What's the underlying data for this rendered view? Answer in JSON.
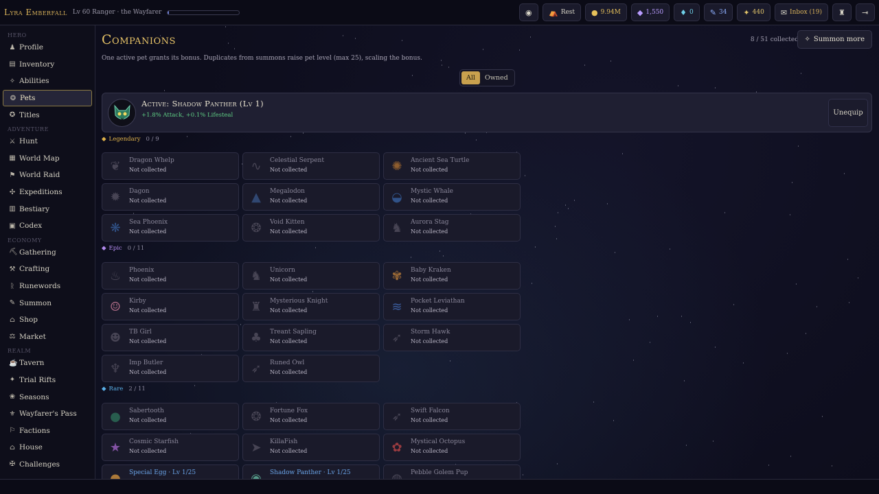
{
  "hero": {
    "name": "Lyra Emberfall",
    "subtitle": "Lv 60 Ranger · the Wayfarer",
    "xp_fraction": 0.02
  },
  "topbar": {
    "rest_label": "Rest",
    "gold": "9.94M",
    "gems": "1,550",
    "shards": "0",
    "scrolls": "34",
    "energy": "440",
    "inbox_label": "Inbox (19)"
  },
  "sidebar": {
    "sections": [
      {
        "title": "Hero",
        "items": [
          {
            "label": "Profile",
            "icon": "person-icon"
          },
          {
            "label": "Inventory",
            "icon": "backpack-icon"
          },
          {
            "label": "Abilities",
            "icon": "sparkle-icon"
          },
          {
            "label": "Pets",
            "icon": "paw-icon",
            "active": true
          },
          {
            "label": "Titles",
            "icon": "title-icon"
          }
        ]
      },
      {
        "title": "Adventure",
        "items": [
          {
            "label": "Hunt",
            "icon": "swords-icon"
          },
          {
            "label": "World Map",
            "icon": "map-icon"
          },
          {
            "label": "World Raid",
            "icon": "raid-icon"
          },
          {
            "label": "Expeditions",
            "icon": "compass-icon"
          },
          {
            "label": "Bestiary",
            "icon": "book-icon"
          },
          {
            "label": "Codex",
            "icon": "codex-icon"
          }
        ]
      },
      {
        "title": "Economy",
        "items": [
          {
            "label": "Gathering",
            "icon": "pickaxe-icon"
          },
          {
            "label": "Crafting",
            "icon": "hammer-icon"
          },
          {
            "label": "Runewords",
            "icon": "rune-icon"
          },
          {
            "label": "Summon",
            "icon": "wand-icon"
          },
          {
            "label": "Shop",
            "icon": "shop-icon"
          },
          {
            "label": "Market",
            "icon": "market-icon"
          }
        ]
      },
      {
        "title": "Realm",
        "items": [
          {
            "label": "Tavern",
            "icon": "mug-icon"
          },
          {
            "label": "Trial Rifts",
            "icon": "rift-icon"
          },
          {
            "label": "Seasons",
            "icon": "leaf-icon"
          },
          {
            "label": "Wayfarer's Pass",
            "icon": "pass-icon"
          },
          {
            "label": "Factions",
            "icon": "flag-icon"
          },
          {
            "label": "House",
            "icon": "house-icon"
          },
          {
            "label": "Challenges",
            "icon": "challenge-icon"
          }
        ]
      }
    ]
  },
  "page": {
    "title": "Companions",
    "description": "One active pet grants its bonus. Duplicates from summons raise pet level (max 25), scaling the bonus.",
    "collected": "8 / 51 collected",
    "summon_label": "Summon more",
    "filters": [
      "All",
      "Owned"
    ],
    "active": {
      "title": "Active: Shadow Panther (Lv 1)",
      "bonus": "+1.8% Attack, +0.1% Lifesteal",
      "unequip_label": "Unequip"
    }
  },
  "rarities": [
    {
      "name": "Legendary",
      "count": "0 / 9",
      "color": "#e0b34a",
      "pets": [
        {
          "name": "Dragon Whelp",
          "status": "Not collected",
          "icon": "dragon-icon"
        },
        {
          "name": "Celestial Serpent",
          "status": "Not collected",
          "icon": "serpent-icon"
        },
        {
          "name": "Ancient Sea Turtle",
          "status": "Not collected",
          "icon": "turtle-icon"
        },
        {
          "name": "Dagon",
          "status": "Not collected",
          "icon": "dagon-icon"
        },
        {
          "name": "Megalodon",
          "status": "Not collected",
          "icon": "shark-icon"
        },
        {
          "name": "Mystic Whale",
          "status": "Not collected",
          "icon": "whale-icon"
        },
        {
          "name": "Sea Phoenix",
          "status": "Not collected",
          "icon": "phoenix-icon"
        },
        {
          "name": "Void Kitten",
          "status": "Not collected",
          "icon": "paw-icon"
        },
        {
          "name": "Aurora Stag",
          "status": "Not collected",
          "icon": "stag-icon"
        }
      ]
    },
    {
      "name": "Epic",
      "count": "0 / 11",
      "color": "#b48cf0",
      "pets": [
        {
          "name": "Phoenix",
          "status": "Not collected",
          "icon": "flame-icon"
        },
        {
          "name": "Unicorn",
          "status": "Not collected",
          "icon": "unicorn-icon"
        },
        {
          "name": "Baby Kraken",
          "status": "Not collected",
          "icon": "kraken-icon"
        },
        {
          "name": "Kirby",
          "status": "Not collected",
          "icon": "kirby-icon"
        },
        {
          "name": "Mysterious Knight",
          "status": "Not collected",
          "icon": "knight-icon"
        },
        {
          "name": "Pocket Leviathan",
          "status": "Not collected",
          "icon": "leviathan-icon"
        },
        {
          "name": "TB Girl",
          "status": "Not collected",
          "icon": "girl-icon"
        },
        {
          "name": "Treant Sapling",
          "status": "Not collected",
          "icon": "tree-icon"
        },
        {
          "name": "Storm Hawk",
          "status": "Not collected",
          "icon": "feather-icon"
        },
        {
          "name": "Imp Butler",
          "status": "Not collected",
          "icon": "imp-icon"
        },
        {
          "name": "Runed Owl",
          "status": "Not collected",
          "icon": "feather-icon"
        }
      ]
    },
    {
      "name": "Rare",
      "count": "2 / 11",
      "color": "#5ab0e8",
      "pets": [
        {
          "name": "Sabertooth",
          "status": "Not collected",
          "icon": "sabertooth-icon"
        },
        {
          "name": "Fortune Fox",
          "status": "Not collected",
          "icon": "paw-icon"
        },
        {
          "name": "Swift Falcon",
          "status": "Not collected",
          "icon": "feather-icon"
        },
        {
          "name": "Cosmic Starfish",
          "status": "Not collected",
          "icon": "star-icon"
        },
        {
          "name": "KillaFish",
          "status": "Not collected",
          "icon": "fish-icon"
        },
        {
          "name": "Mystical Octopus",
          "status": "Not collected",
          "icon": "octopus-icon"
        },
        {
          "name": "Special Egg · Lv 1/25",
          "status": "",
          "icon": "egg-icon",
          "owned": true
        },
        {
          "name": "Shadow Panther · Lv 1/25",
          "status": "",
          "icon": "panther-icon",
          "owned": true
        },
        {
          "name": "Pebble Golem Pup",
          "status": "",
          "icon": "golem-icon"
        }
      ]
    }
  ]
}
